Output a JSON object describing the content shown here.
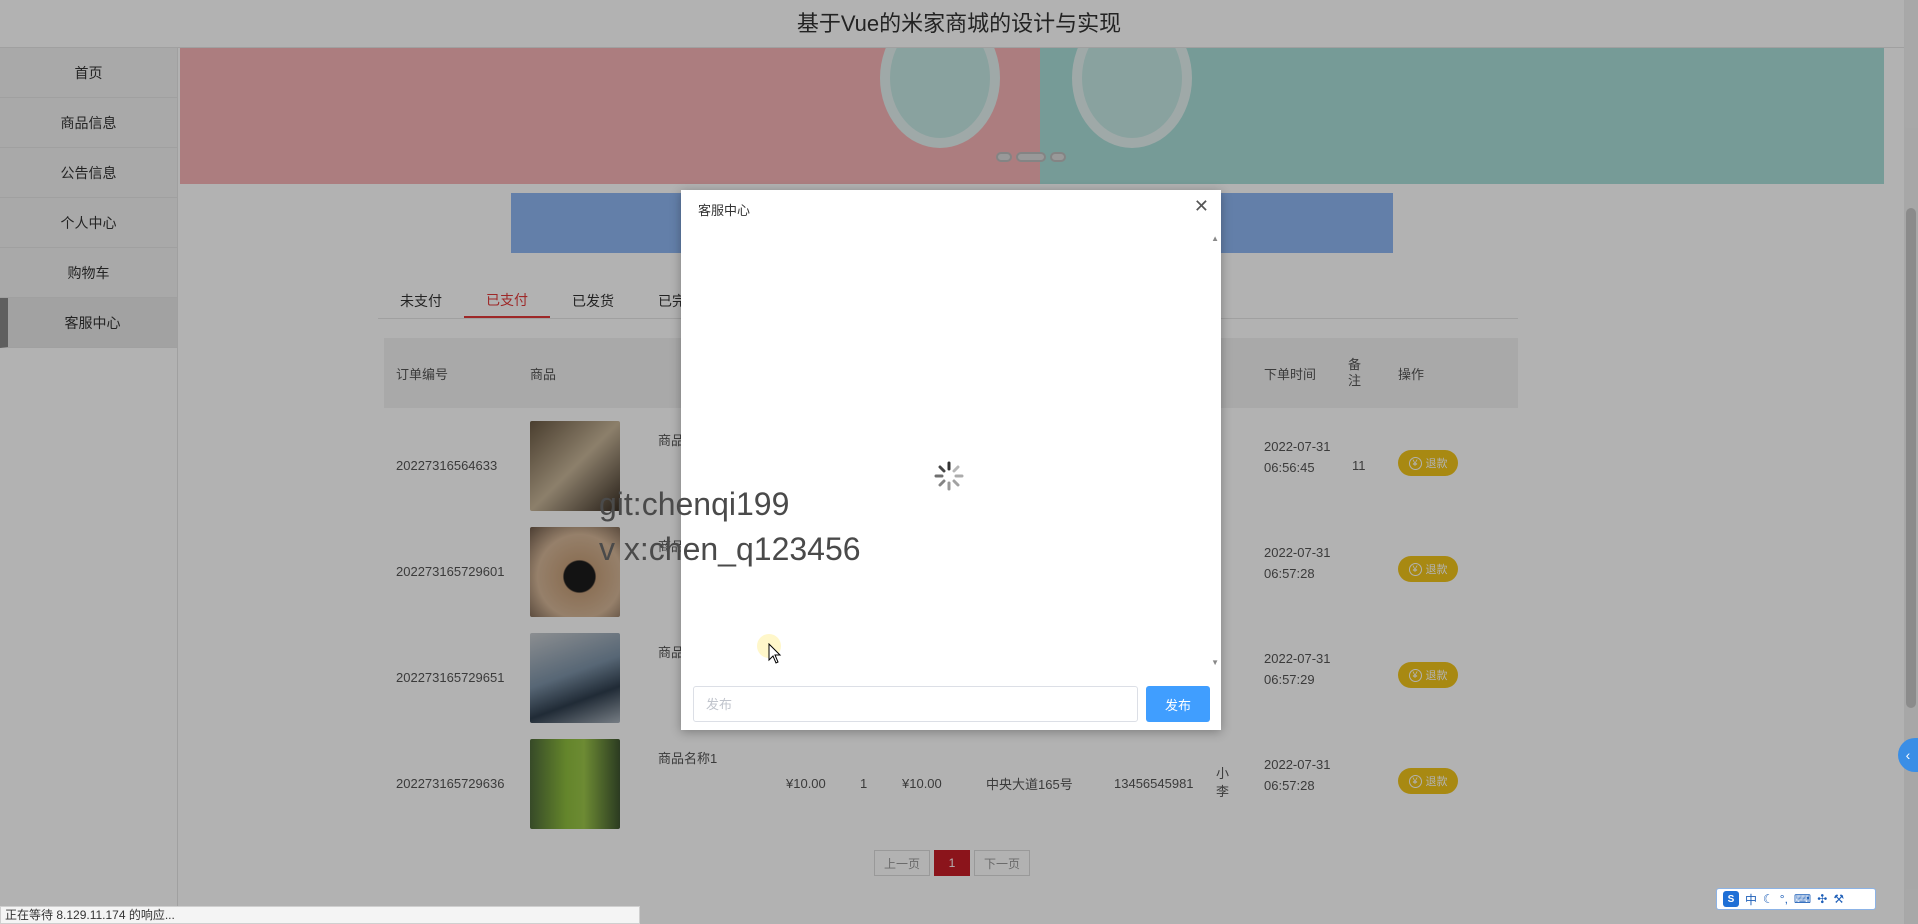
{
  "header": {
    "title": "基于Vue的米家商城的设计与实现"
  },
  "sidebar": {
    "items": [
      {
        "label": "首页"
      },
      {
        "label": "商品信息"
      },
      {
        "label": "公告信息"
      },
      {
        "label": "个人中心"
      },
      {
        "label": "购物车"
      },
      {
        "label": "客服中心"
      }
    ]
  },
  "orders": {
    "tabs": [
      {
        "label": "未支付"
      },
      {
        "label": "已支付"
      },
      {
        "label": "已发货"
      },
      {
        "label": "已完成"
      }
    ],
    "headers": {
      "order_no": "订单编号",
      "product": "商品",
      "order_time": "下单时间",
      "remark": "备注",
      "action": "操作"
    },
    "rows": [
      {
        "order_no": "20227316564633",
        "name": "商品名称",
        "time": "2022-07-31 06:56:45",
        "remark": "11",
        "action": "退款"
      },
      {
        "order_no": "202273165729601",
        "name": "商品名称",
        "time": "2022-07-31 06:57:28",
        "remark": "",
        "action": "退款"
      },
      {
        "order_no": "202273165729651",
        "name": "商品名称",
        "time": "2022-07-31 06:57:29",
        "remark": "",
        "action": "退款"
      },
      {
        "order_no": "202273165729636",
        "name": "商品名称1",
        "price": "¥10.00",
        "qty": "1",
        "total": "¥10.00",
        "address": "中央大道165号",
        "phone": "13456545981",
        "receiver": "小李",
        "time": "2022-07-31 06:57:28",
        "remark": "",
        "action": "退款"
      }
    ],
    "pager": {
      "prev": "上一页",
      "current": "1",
      "next": "下一页"
    }
  },
  "dialog": {
    "title": "客服中心",
    "input_placeholder": "发布",
    "send_label": "发布"
  },
  "watermark": {
    "line1": "git:chenqi199",
    "line2": "v x:chen_q123456"
  },
  "status_bar": "正在等待 8.129.11.174 的响应...",
  "ime": {
    "mode": "中",
    "logo": "S"
  }
}
